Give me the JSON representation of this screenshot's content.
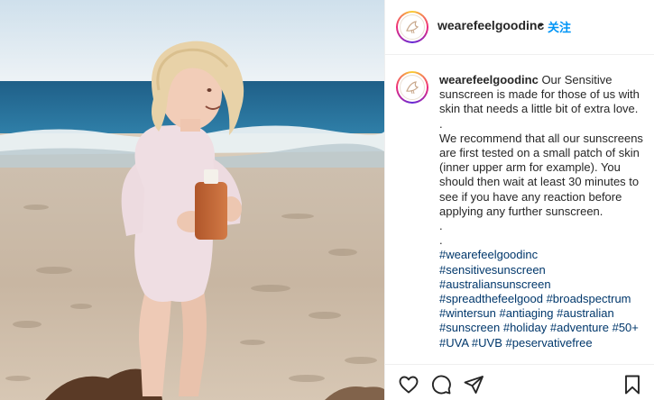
{
  "post": {
    "username": "wearefeelgoodinc",
    "dot": "•",
    "follow_label": "关注"
  },
  "caption": {
    "username": "wearefeelgoodinc",
    "intro": "Our Sensitive sunscreen is made for those of us with skin that needs a little bit of extra love.",
    "sep1": ".",
    "body": "We recommend that all our sunscreens are first tested on a small patch of skin (inner upper arm for example). You should then wait at least 30 minutes to see if you have any reaction before applying any further sunscreen.",
    "sep2": ".",
    "sep3": ".",
    "hashtags": [
      "#wearefeelgoodinc",
      "#sensitivesunscreen",
      "#australiansunscreen",
      "#spreadthefeelgood",
      "#broadspectrum",
      "#wintersun",
      "#antiaging",
      "#australian",
      "#sunscreen",
      "#holiday",
      "#adventure",
      "#50+",
      "#UVA",
      "#UVB",
      "#peservativefree"
    ]
  },
  "actions": {
    "icons": [
      "heart-icon",
      "comment-icon",
      "share-icon",
      "bookmark-icon"
    ]
  },
  "colors": {
    "link": "#00376b",
    "follow": "#0095f6",
    "text": "#262626",
    "border": "#efefef"
  }
}
